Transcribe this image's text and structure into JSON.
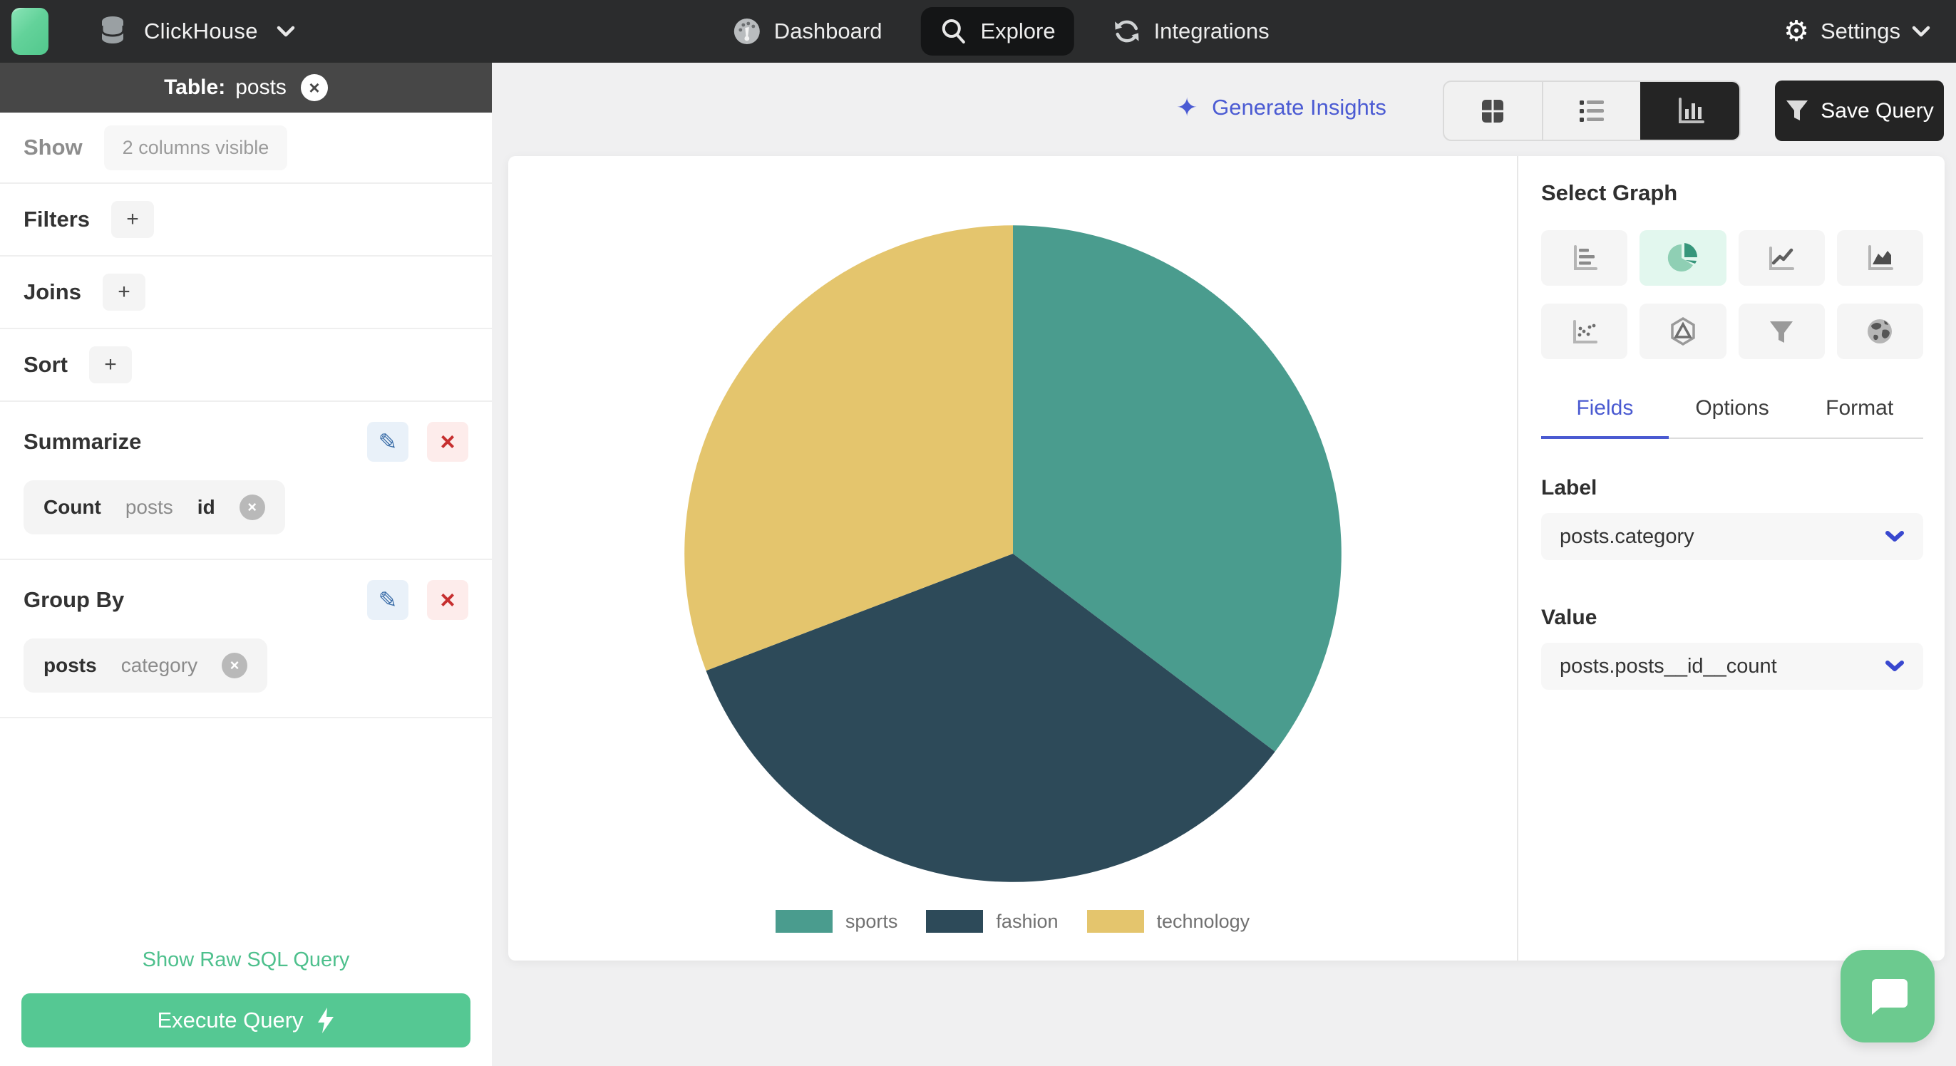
{
  "icons": {
    "gear": "⚙",
    "sparkle": "✦",
    "pencil": "✎",
    "bolt": "⚡",
    "close": "×",
    "plus": "+",
    "x": "×"
  },
  "topbar": {
    "app_name": "ClickHouse",
    "nav": [
      {
        "label": "Dashboard",
        "active": false
      },
      {
        "label": "Explore",
        "active": true
      },
      {
        "label": "Integrations",
        "active": false
      }
    ],
    "settings_label": "Settings"
  },
  "sidebar": {
    "table_label": "Table:",
    "table_name": "posts",
    "show_label": "Show",
    "show_chip": "2 columns visible",
    "sections": [
      {
        "label": "Filters"
      },
      {
        "label": "Joins"
      },
      {
        "label": "Sort"
      }
    ],
    "summarize": {
      "label": "Summarize",
      "chip": [
        "Count",
        "posts",
        "id"
      ]
    },
    "group_by": {
      "label": "Group By",
      "chip": [
        "posts",
        "category"
      ]
    },
    "raw_sql_link": "Show Raw SQL Query",
    "execute_label": "Execute Query"
  },
  "toolbar": {
    "generate_insights_label": "Generate Insights",
    "save_query_label": "Save Query"
  },
  "graph_panel": {
    "title": "Select Graph",
    "graph_types": [
      "bar",
      "pie",
      "line",
      "area",
      "scatter",
      "radar",
      "funnel",
      "map"
    ],
    "active_graph": "pie",
    "tabs": [
      {
        "label": "Fields"
      },
      {
        "label": "Options"
      },
      {
        "label": "Format"
      }
    ],
    "active_tab": "Fields",
    "label_field": {
      "label": "Label",
      "value": "posts.category"
    },
    "value_field": {
      "label": "Value",
      "value": "posts.posts__id__count"
    }
  },
  "chart_data": {
    "type": "pie",
    "title": "",
    "categories": [
      "sports",
      "fashion",
      "technology"
    ],
    "values": [
      35.3,
      33.9,
      30.8
    ],
    "value_unit": "share_pct_estimated_from_slice_angles",
    "colors": [
      "#4a9c8e",
      "#2d4a59",
      "#e4c56d"
    ],
    "legend_position": "bottom",
    "label_source": "posts.category",
    "value_source": "posts.posts__id__count"
  },
  "accent_colors": {
    "green": "#55c893",
    "indigo": "#4a5ad1",
    "dark": "#242424",
    "red": "#c62f2f",
    "blue_edit": "#3a6da8"
  }
}
